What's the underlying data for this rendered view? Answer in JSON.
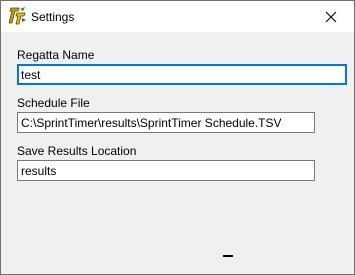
{
  "window": {
    "title": "Settings",
    "app_icon": "sprinttimer-app-icon",
    "close_icon": "close-icon"
  },
  "form": {
    "regatta_name": {
      "label": "Regatta Name",
      "value": "test"
    },
    "schedule_file": {
      "label": "Schedule File",
      "value": "C:\\SprintTimer\\results\\SprintTimer Schedule.TSV"
    },
    "save_results_location": {
      "label": "Save Results Location",
      "value": "results"
    }
  },
  "colors": {
    "focus_border": "#0078d7",
    "window_background": "#f0f0f0",
    "titlebar_background": "#ffffff"
  }
}
